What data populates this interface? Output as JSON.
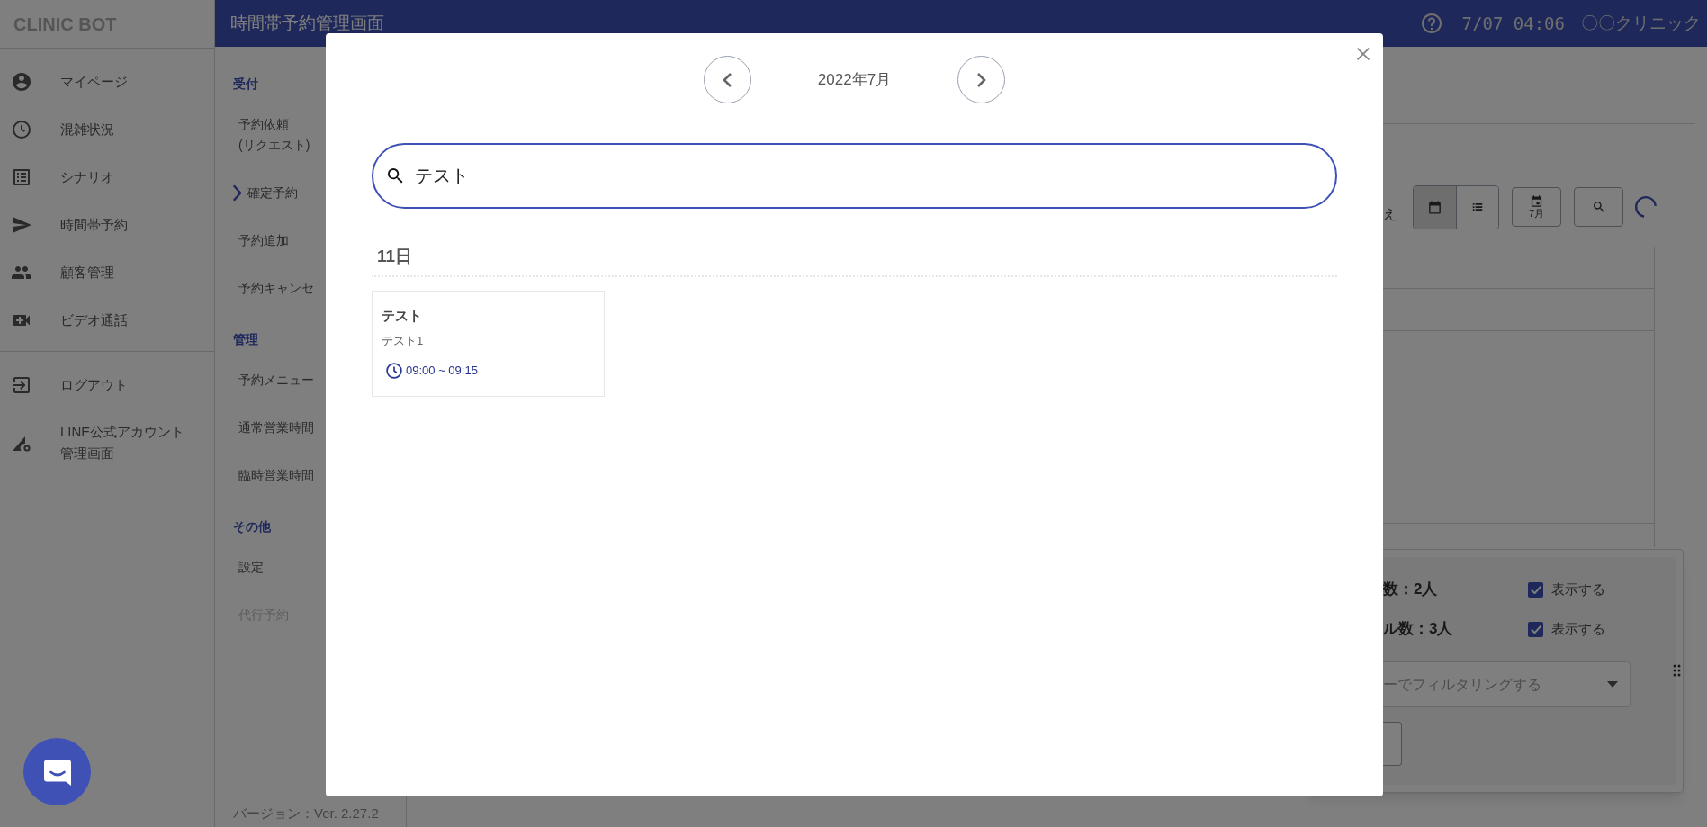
{
  "sidebar": {
    "brand": "CLINIC BOT",
    "groups": [
      [
        {
          "label": "マイページ"
        },
        {
          "label": "混雑状況"
        },
        {
          "label": "シナリオ"
        },
        {
          "label": "時間帯予約"
        },
        {
          "label": "顧客管理"
        },
        {
          "label": "ビデオ通話"
        }
      ],
      [
        {
          "label": "ログアウト"
        },
        {
          "label": "LINE公式アカウント管理画面"
        }
      ]
    ]
  },
  "topbar": {
    "title": "時間帯予約管理画面",
    "datetime": "7/07 04:06",
    "clinic": "〇〇クリニック"
  },
  "submenu": {
    "sections": [
      {
        "title": "受付",
        "items": [
          {
            "label": "予約依頼\n(リクエスト)",
            "selected": false,
            "disabled": false
          },
          {
            "label": "確定予約",
            "selected": true,
            "disabled": false
          },
          {
            "label": "予約追加",
            "selected": false,
            "disabled": false
          },
          {
            "label": "予約キャンセ",
            "selected": false,
            "disabled": false
          }
        ]
      },
      {
        "title": "管理",
        "items": [
          {
            "label": "予約メニュー",
            "selected": false,
            "disabled": false
          },
          {
            "label": "通常営業時間",
            "selected": false,
            "disabled": false
          },
          {
            "label": "臨時営業時間",
            "selected": false,
            "disabled": false
          }
        ]
      },
      {
        "title": "その他",
        "items": [
          {
            "label": "設定",
            "selected": false,
            "disabled": false
          },
          {
            "label": "代行予約",
            "selected": false,
            "disabled": true
          }
        ]
      }
    ],
    "version": "バージョン：Ver. 2.27.2"
  },
  "background": {
    "toolbar_label": "え",
    "view_toggle": [
      {
        "selected": true
      },
      {
        "selected": false
      }
    ],
    "month_button": "7月",
    "summary": [
      {
        "label": "数：2人",
        "checked": true,
        "checkbox_label": "表示する"
      },
      {
        "label": "ル数：3人",
        "checked": true,
        "checkbox_label": "表示する"
      }
    ],
    "filter": {
      "placeholder": "ーでフィルタリングする"
    }
  },
  "modal": {
    "month": "2022年7月",
    "search": {
      "value": "テスト"
    },
    "days": [
      {
        "day": "11日",
        "events": [
          {
            "title": "テスト",
            "subtitle": "テスト1",
            "time": "09:00 ~ 09:15"
          }
        ]
      }
    ]
  }
}
